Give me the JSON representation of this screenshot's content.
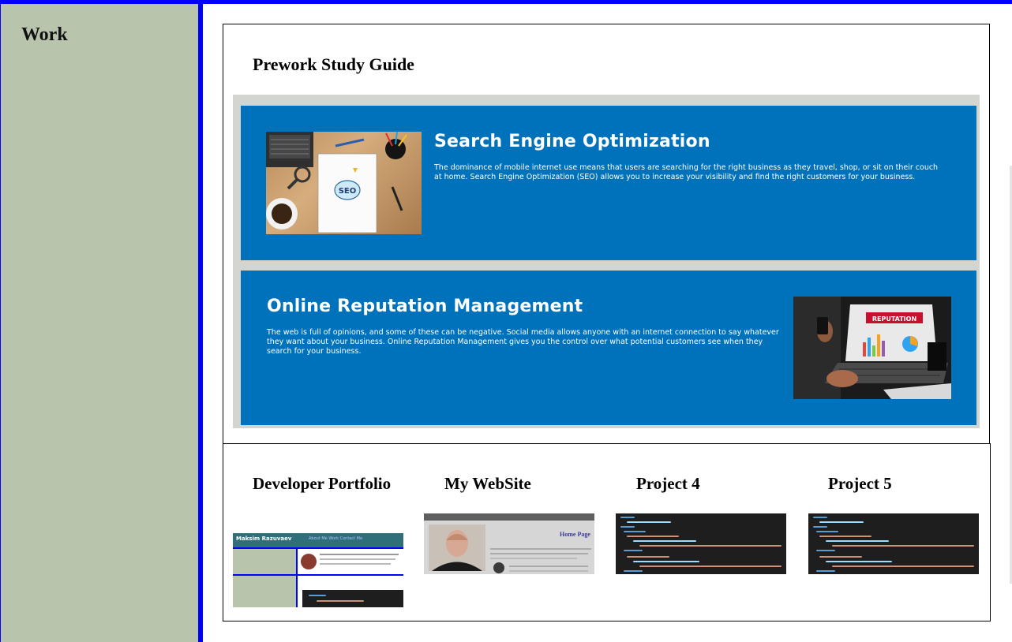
{
  "sidebar": {
    "title": "Work"
  },
  "featured": {
    "title": "Prework Study Guide",
    "cards": [
      {
        "title": "Search Engine Optimization",
        "text": "The dominance of mobile internet use means that users are searching for the right business as they travel, shop, or sit on their couch at home. Search Engine Optimization (SEO) allows you to increase your visibility and find the right customers for your business.",
        "image_text": "SEO"
      },
      {
        "title": "Online Reputation Management",
        "text": "The web is full of opinions, and some of these can be negative. Social media allows anyone with an internet connection to say whatever they want about your business. Online Reputation Management gives you the control over what potential customers see when they search for your business.",
        "image_text": "REPUTATION"
      }
    ]
  },
  "projects": [
    {
      "title": "Developer Portfolio",
      "thumb_name": "Maksim Razuvaev",
      "thumb_nav": "About Me  Work  Contact Me"
    },
    {
      "title": "My WebSite",
      "thumb_heading": "Home Page"
    },
    {
      "title": "Project 4"
    },
    {
      "title": "Project 5"
    }
  ],
  "colors": {
    "sidebar_bg": "#b8c5ac",
    "frame_blue": "#0000ff",
    "card_blue": "#0072bb",
    "panel_gray": "#d3d6d0",
    "code_bg": "#1e1e1e"
  }
}
